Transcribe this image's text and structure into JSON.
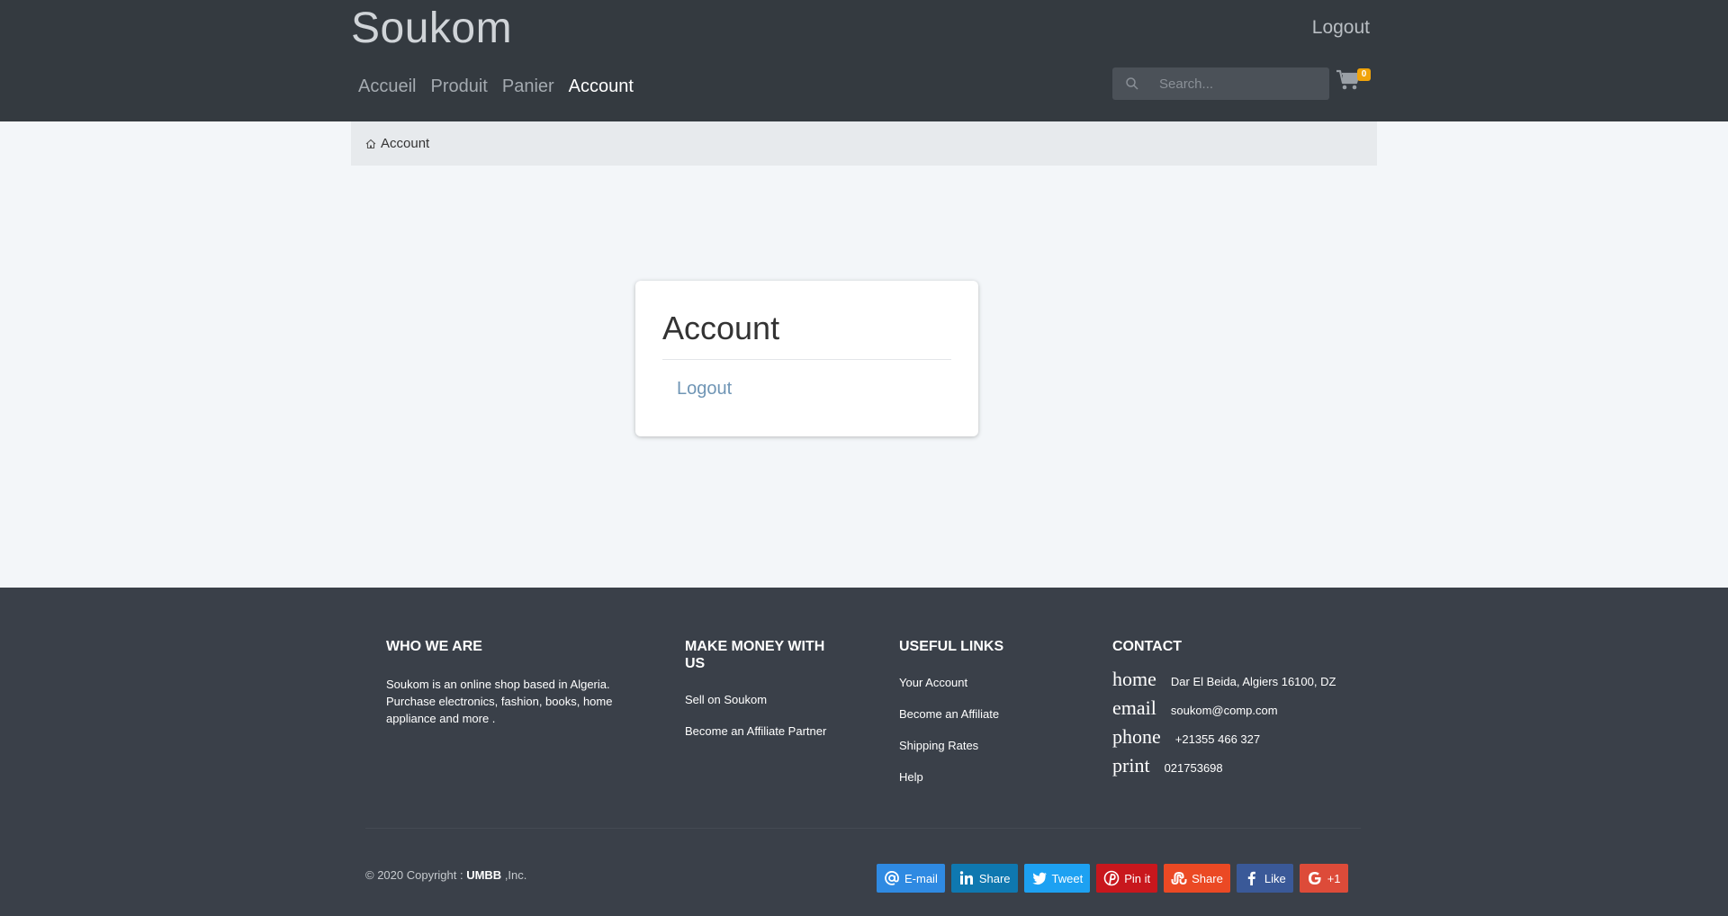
{
  "header": {
    "brand": "Soukom",
    "logout_label": "Logout",
    "nav": [
      {
        "label": "Accueil",
        "active": false
      },
      {
        "label": "Produit",
        "active": false
      },
      {
        "label": "Panier",
        "active": false
      },
      {
        "label": "Account",
        "active": true
      }
    ],
    "search_placeholder": "Search...",
    "cart_count": "0",
    "cart_icon": "shopping-cart-icon",
    "search_icon": "search-icon"
  },
  "breadcrumb": {
    "icon": "home-icon",
    "current": "Account"
  },
  "account_card": {
    "title": "Account",
    "logout_link": "Logout"
  },
  "footer": {
    "who": {
      "heading": "WHO WE ARE",
      "text": "Soukom is an online shop based in Algeria. Purchase electronics, fashion, books, home appliance and more ."
    },
    "money": {
      "heading": "MAKE MONEY WITH US",
      "links": [
        "Sell on Soukom",
        "Become an Affiliate Partner"
      ]
    },
    "useful": {
      "heading": "USEFUL LINKS",
      "links": [
        "Your Account",
        "Become an Affiliate",
        "Shipping Rates",
        "Help"
      ]
    },
    "contact": {
      "heading": "CONTACT",
      "rows": [
        {
          "icon": "home",
          "text": "Dar El Beida, Algiers 16100, DZ"
        },
        {
          "icon": "email",
          "text": "soukom@comp.com"
        },
        {
          "icon": "phone",
          "text": "+21355 466 327"
        },
        {
          "icon": "print",
          "text": "021753698"
        }
      ]
    },
    "copyright_prefix": "© 2020 Copyright : ",
    "copyright_brand": "UMBB",
    "copyright_suffix": " ,Inc.",
    "share": [
      {
        "label": "E-mail",
        "icon": "at-icon",
        "color": "#2f8ae2"
      },
      {
        "label": "Share",
        "icon": "linkedin-icon",
        "color": "#0f78b0"
      },
      {
        "label": "Tweet",
        "icon": "twitter-icon",
        "color": "#1da1f2"
      },
      {
        "label": "Pin it",
        "icon": "pinterest-icon",
        "color": "#c8171d"
      },
      {
        "label": "Share",
        "icon": "stumbleupon-icon",
        "color": "#eb4924"
      },
      {
        "label": "Like",
        "icon": "facebook-icon",
        "color": "#3a5998"
      },
      {
        "label": "+1",
        "icon": "google-plus-icon",
        "color": "#dd4b39"
      }
    ]
  }
}
